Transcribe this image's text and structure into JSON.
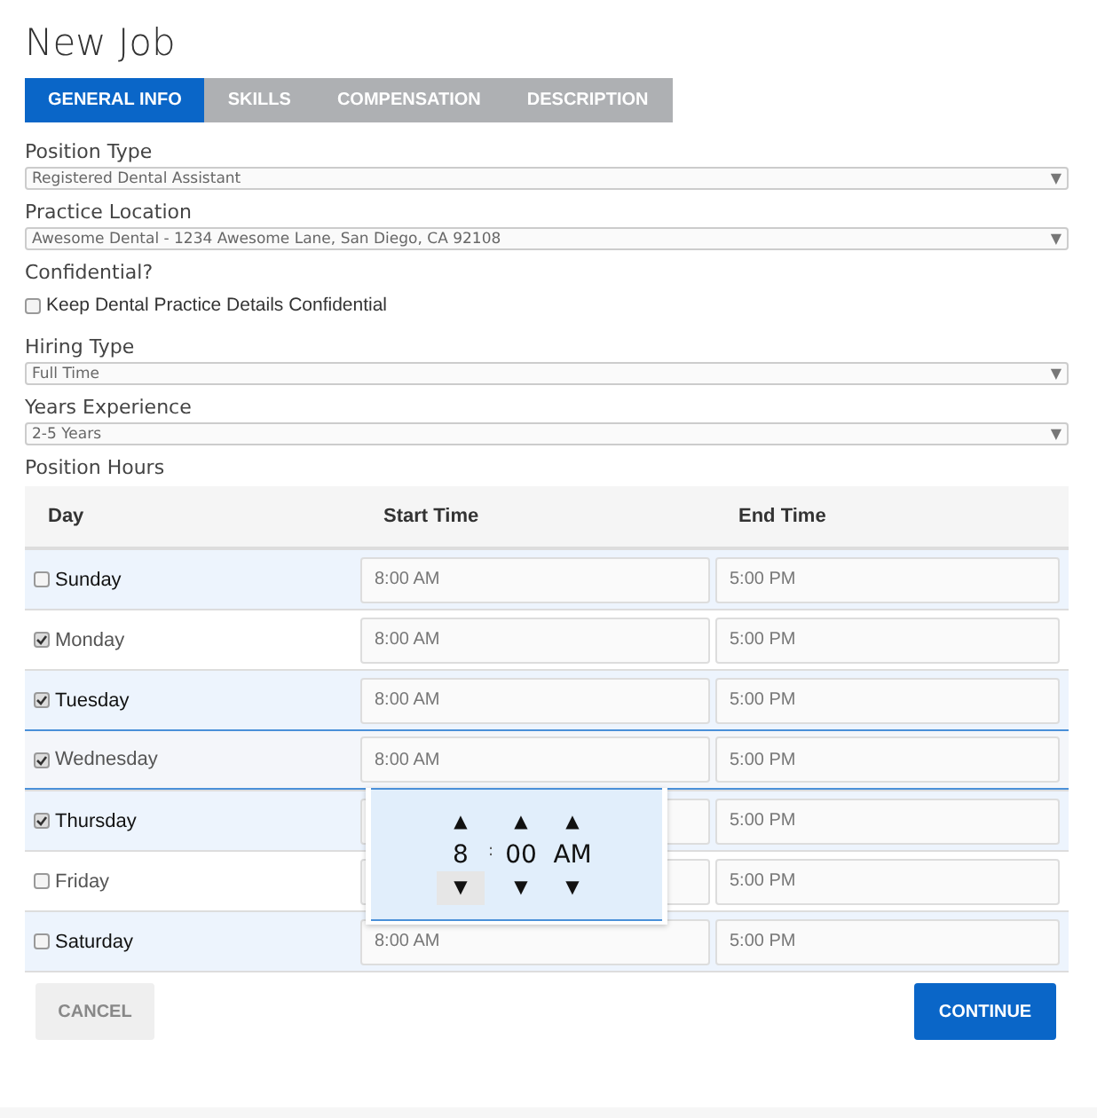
{
  "title": "New Job",
  "tabs": [
    {
      "label": "GENERAL INFO",
      "selected": true
    },
    {
      "label": "SKILLS",
      "selected": false
    },
    {
      "label": "COMPENSATION",
      "selected": false
    },
    {
      "label": "DESCRIPTION",
      "selected": false
    }
  ],
  "fields": [
    {
      "kind": "select",
      "label": "Position Type",
      "value": "Registered Dental Assistant",
      "arrow": "▼"
    },
    {
      "kind": "select",
      "label": "Practice Location",
      "value": "Awesome Dental - 1234 Awesome Lane, San Diego, CA 92108",
      "arrow": "▼"
    },
    {
      "kind": "checkbox",
      "label": "Confidential?",
      "option": "Keep Dental Practice Details Confidential",
      "checked": false
    },
    {
      "kind": "select",
      "label": "Hiring Type",
      "value": "Full Time",
      "arrow": "▼"
    },
    {
      "kind": "select",
      "label": "Years Experience",
      "value": "2-5 Years",
      "arrow": "▼"
    }
  ],
  "hours": {
    "label": "Position Hours",
    "columns": [
      "Day",
      "Start Time",
      "End Time"
    ],
    "rows": [
      {
        "day": "Sunday",
        "checked": false,
        "active": false,
        "start": "8:00 AM",
        "end": "5:00 PM"
      },
      {
        "day": "Monday",
        "checked": true,
        "active": false,
        "start": "8:00 AM",
        "end": "5:00 PM"
      },
      {
        "day": "Tuesday",
        "checked": true,
        "active": false,
        "start": "8:00 AM",
        "end": "5:00 PM"
      },
      {
        "day": "Wednesday",
        "checked": true,
        "active": true,
        "start": "8:00 AM",
        "end": "5:00 PM"
      },
      {
        "day": "Thursday",
        "checked": true,
        "active": false,
        "end": "5:00 PM"
      },
      {
        "day": "Friday",
        "checked": false,
        "active": false,
        "end": "5:00 PM"
      },
      {
        "day": "Saturday",
        "checked": false,
        "active": false,
        "start": "8:00 AM",
        "end": "5:00 PM"
      }
    ],
    "time_picker": [
      {
        "kind": "spinner",
        "up": "▲",
        "value": "8",
        "down": "▼",
        "hovered": true
      },
      {
        "kind": "separator",
        "value": ":"
      },
      {
        "kind": "spinner",
        "up": "▲",
        "value": "00",
        "down": "▼",
        "hovered": false
      },
      {
        "kind": "spinner",
        "up": "▲",
        "value": "AM",
        "down": "▼",
        "hovered": false
      }
    ]
  },
  "buttons": {
    "cancel": "CANCEL",
    "continue": "CONTINUE"
  }
}
